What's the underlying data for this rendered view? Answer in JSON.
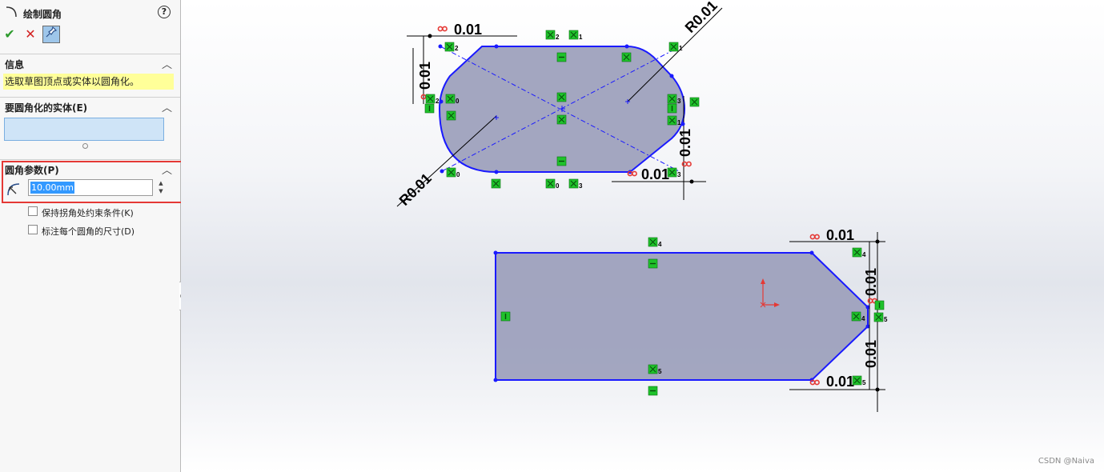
{
  "panel": {
    "title": "绘制圆角",
    "help_label": "?",
    "ok_label": "✔",
    "cancel_label": "✕",
    "pin_label": "📌",
    "info_section": {
      "title": "信息",
      "message": "选取草图顶点或实体以圆角化。"
    },
    "entities_section": {
      "title": "要圆角化的实体(E)"
    },
    "params_section": {
      "title": "圆角参数(P)",
      "radius_value": "10.00mm",
      "keep_constraints_label": "保持拐角处约束条件(K)",
      "dimension_each_label": "标注每个圆角的尺寸(D)"
    }
  },
  "canvas": {
    "dimension_linear": "0.01",
    "dimension_radius": "R0.01",
    "relation_tags": [
      "2",
      "1",
      "0",
      "3",
      "4",
      "5"
    ],
    "watermark": "CSDN @Naiva"
  },
  "colors": {
    "sketch_line": "#1a1aff",
    "sketch_fill": "#9ea1bd",
    "relation_green": "#1fc22b",
    "highlight_red": "#e53935",
    "selection_yellow": "#ffff99"
  }
}
